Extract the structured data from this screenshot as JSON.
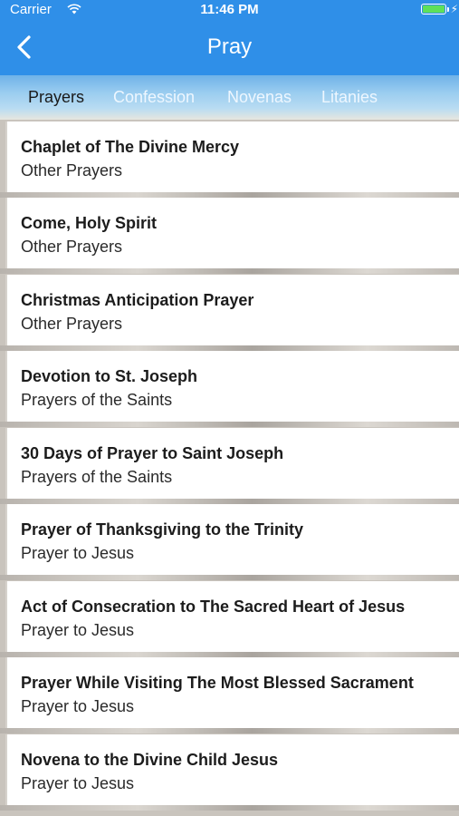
{
  "status": {
    "carrier": "Carrier",
    "time": "11:46 PM",
    "battery_level": 1.0
  },
  "nav": {
    "title": "Pray",
    "back_icon": "chevron-left-icon"
  },
  "tabs": [
    {
      "label": "Prayers",
      "active": true
    },
    {
      "label": "Confession",
      "active": false
    },
    {
      "label": "Novenas",
      "active": false
    },
    {
      "label": "Litanies",
      "active": false
    }
  ],
  "prayers": [
    {
      "title": "Chaplet of The Divine Mercy",
      "category": "Other Prayers"
    },
    {
      "title": "Come, Holy Spirit",
      "category": "Other Prayers"
    },
    {
      "title": "Christmas Anticipation Prayer",
      "category": "Other Prayers"
    },
    {
      "title": "Devotion to St. Joseph",
      "category": "Prayers of the Saints"
    },
    {
      "title": "30 Days of Prayer to Saint Joseph",
      "category": "Prayers of the Saints"
    },
    {
      "title": "Prayer of Thanksgiving to the Trinity",
      "category": "Prayer to Jesus"
    },
    {
      "title": "Act of Consecration to The Sacred Heart of Jesus",
      "category": "Prayer to Jesus"
    },
    {
      "title": "Prayer While Visiting The Most Blessed Sacrament",
      "category": "Prayer to Jesus"
    },
    {
      "title": "Novena to the Divine Child Jesus",
      "category": "Prayer to Jesus"
    }
  ],
  "colors": {
    "accent": "#2f8fe8",
    "active_tab_text": "#1a1a1a",
    "inactive_tab_text": "#eef7ff",
    "card_bg": "#ffffff"
  }
}
